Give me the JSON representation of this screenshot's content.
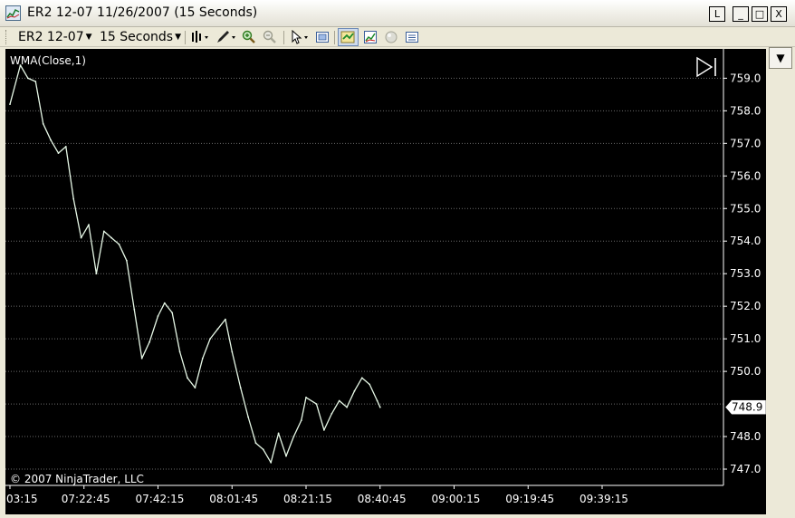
{
  "window": {
    "title": "ER2 12-07  11/26/2007 (15 Seconds)",
    "buttons": [
      "L",
      "_",
      "□",
      "X"
    ]
  },
  "toolbar": {
    "instrument": "ER2 12-07",
    "interval": "15 Seconds",
    "icons": [
      "bar-style-icon",
      "drawing-pencil-icon",
      "zoom-in-icon",
      "zoom-out-icon",
      "cursor-arrow-icon",
      "properties-icon",
      "strategy-icon",
      "indicator-icon",
      "sphere-icon",
      "data-box-icon"
    ]
  },
  "chart": {
    "indicator_label": "WMA(Close,1)",
    "copyright": "© 2007 NinjaTrader, LLC",
    "last_price": "748.9",
    "colors": {
      "background": "#000000",
      "grid": "#6a6a6a",
      "axis_text": "#ffffff",
      "price_line": "#e6f7e6",
      "price_marker_bg": "#ffffff"
    },
    "y_ticks": [
      "759.0",
      "758.0",
      "757.0",
      "756.0",
      "755.0",
      "754.0",
      "753.0",
      "752.0",
      "751.0",
      "750.0",
      "748.0",
      "747.0"
    ],
    "x_ticks": [
      "03:15",
      "07:22:45",
      "07:42:15",
      "08:01:45",
      "08:21:15",
      "08:40:45",
      "09:00:15",
      "09:19:45",
      "09:39:15"
    ]
  },
  "chart_data": {
    "type": "line",
    "title": "",
    "xlabel": "",
    "ylabel": "",
    "ylim": [
      746.5,
      759.9
    ],
    "x": [
      "07:03:15",
      "07:06:00",
      "07:08:00",
      "07:10:00",
      "07:12:00",
      "07:14:00",
      "07:16:00",
      "07:18:00",
      "07:20:00",
      "07:22:00",
      "07:24:00",
      "07:26:00",
      "07:28:00",
      "07:30:00",
      "07:32:00",
      "07:34:00",
      "07:36:00",
      "07:38:00",
      "07:40:00",
      "07:42:15",
      "07:44:00",
      "07:46:00",
      "07:48:00",
      "07:50:00",
      "07:52:00",
      "07:54:00",
      "07:56:00",
      "07:58:00",
      "08:00:00",
      "08:01:45",
      "08:04:00",
      "08:06:00",
      "08:08:00",
      "08:10:00",
      "08:12:00",
      "08:14:00",
      "08:16:00",
      "08:18:00",
      "08:20:00",
      "08:21:15",
      "08:24:00",
      "08:26:00",
      "08:28:00",
      "08:30:00",
      "08:32:00",
      "08:34:00",
      "08:36:00",
      "08:38:00",
      "08:40:00",
      "08:40:45"
    ],
    "series": [
      {
        "values": [
          758.2,
          759.4,
          759.0,
          758.9,
          757.6,
          757.1,
          756.7,
          756.9,
          755.3,
          754.1,
          754.5,
          753.0,
          754.3,
          754.1,
          753.9,
          753.4,
          751.9,
          750.4,
          750.9,
          751.7,
          752.1,
          751.8,
          750.6,
          749.8,
          749.5,
          750.4,
          751.0,
          751.3,
          751.6,
          750.6,
          749.5,
          748.6,
          747.8,
          747.6,
          747.2,
          748.1,
          747.4,
          748.0,
          748.5,
          749.2,
          749.0,
          748.2,
          748.7,
          749.1,
          748.9,
          749.4,
          749.8,
          749.6,
          749.1,
          748.9
        ]
      }
    ]
  }
}
